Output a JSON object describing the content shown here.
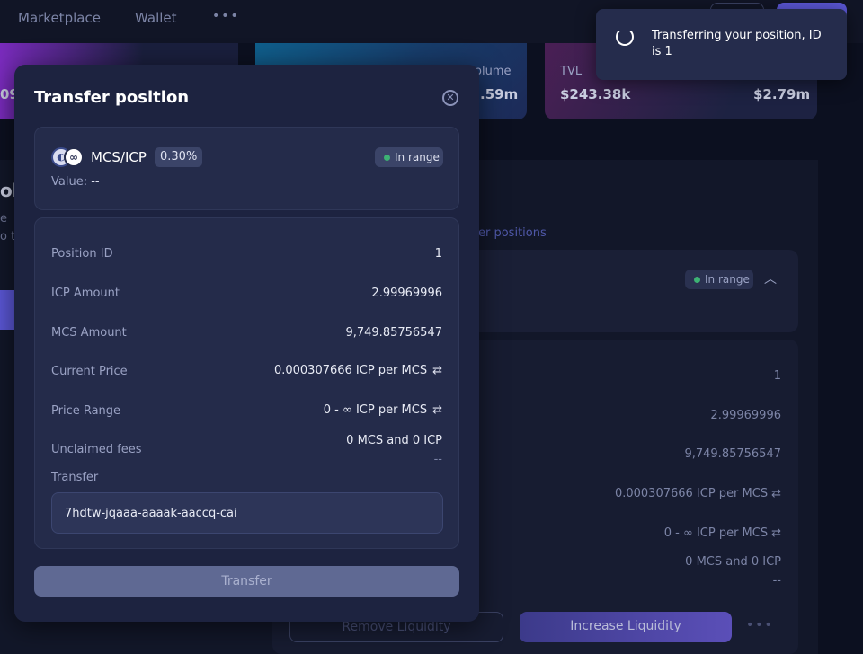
{
  "nav": {
    "items": [
      "Marketplace",
      "Wallet"
    ],
    "more": "•••"
  },
  "stats": {
    "left_value": "09",
    "volume_label": "olume",
    "volume_value": ".59m",
    "tvl_label": "TVL",
    "tvl_value": "$243.38k",
    "tvl_value2": "$2.79m"
  },
  "background": {
    "side_heading": "ol",
    "side_text_1": "e",
    "side_text_2": "o t",
    "positions_link": "er positions",
    "range_badge": "In range",
    "amounts": [
      "1",
      "2.99969996",
      "9,749.85756547",
      "0.000307666 ICP per MCS",
      "0 - ∞ ICP per MCS",
      "0 MCS and 0 ICP"
    ],
    "fees_sub": "--",
    "remove_label": "Remove Liquidity",
    "increase_label": "Increase Liquidity",
    "more": "•••"
  },
  "modal": {
    "title": "Transfer position",
    "close_icon": "⊗",
    "pair": {
      "token_a_icon": "◐",
      "token_b_icon": "∞",
      "name": "MCS/ICP",
      "fee": "0.30%",
      "range_status": "In range",
      "value_label": "Value:",
      "value": "--"
    },
    "details": {
      "position_id_label": "Position ID",
      "position_id": "1",
      "icp_amount_label": "ICP Amount",
      "icp_amount": "2.99969996",
      "mcs_amount_label": "MCS Amount",
      "mcs_amount": "9,749.85756547",
      "current_price_label": "Current Price",
      "current_price": "0.000307666 ICP per MCS",
      "price_range_label": "Price Range",
      "price_range": "0 - ∞ ICP per MCS",
      "unclaimed_fees_label": "Unclaimed fees",
      "unclaimed_fees": "0 MCS and 0 ICP",
      "unclaimed_fees_sub": "--",
      "transfer_label": "Transfer",
      "transfer_value": "7hdtw-jqaaa-aaaak-aaccq-cai"
    },
    "swap_icon": "⇄",
    "transfer_button": "Transfer"
  },
  "toast": {
    "message": "Transferring your position, ID is 1"
  }
}
